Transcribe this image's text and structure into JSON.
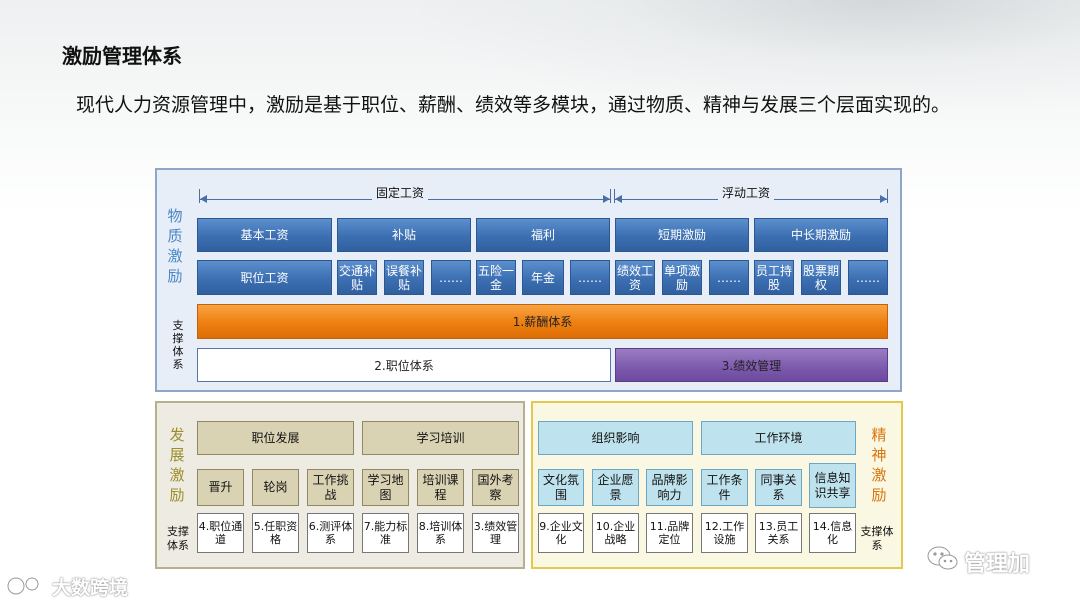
{
  "title": "激励管理体系",
  "subtitle": "现代人力资源管理中，激励是基于职位、薪酬、绩效等多模块，通过物质、精神与发展三个层面实现的。",
  "material": {
    "label": "物质激励",
    "support_label": "支撑体系",
    "fixed_header": "固定工资",
    "float_header": "浮动工资",
    "row1": [
      "基本工资",
      "补贴",
      "福利",
      "短期激励",
      "中长期激励"
    ],
    "row2": [
      "职位工资",
      "交通补贴",
      "误餐补贴",
      "……",
      "五险一金",
      "年金",
      "……",
      "绩效工资",
      "单项激励",
      "……",
      "员工持股",
      "股票期权",
      "……"
    ],
    "salary_bar": "1.薪酬体系",
    "position_bar": "2.职位体系",
    "performance_bar": "3.绩效管理"
  },
  "development": {
    "label": "发展激励",
    "support_label": "支撑体系",
    "headers": [
      "职位发展",
      "学习培训"
    ],
    "items": [
      "晋升",
      "轮岗",
      "工作挑战",
      "学习地图",
      "培训课程",
      "国外考察"
    ],
    "support": [
      "4.职位通道",
      "5.任职资格",
      "6.测评体系",
      "7.能力标准",
      "8.培训体系",
      "3.绩效管理"
    ]
  },
  "spiritual": {
    "label": "精神激励",
    "support_label": "支撑体系",
    "headers": [
      "组织影响",
      "工作环境"
    ],
    "items": [
      "文化氛围",
      "企业愿景",
      "品牌影响力",
      "工作条件",
      "同事关系",
      "信息知识共享"
    ],
    "support": [
      "9.企业文化",
      "10.企业战略",
      "11.品牌定位",
      "12.工作设施",
      "13.员工关系",
      "14.信息化"
    ]
  },
  "watermarks": {
    "left": "大数跨境",
    "right": "管理加"
  },
  "colors": {
    "blue_box": "#3c6fb2",
    "orange_bar": "#ee7f10",
    "purple_bar": "#7c59ad",
    "material_label": "#4a86c5",
    "development_label": "#9c8e2a",
    "spiritual_label": "#d9760f"
  }
}
